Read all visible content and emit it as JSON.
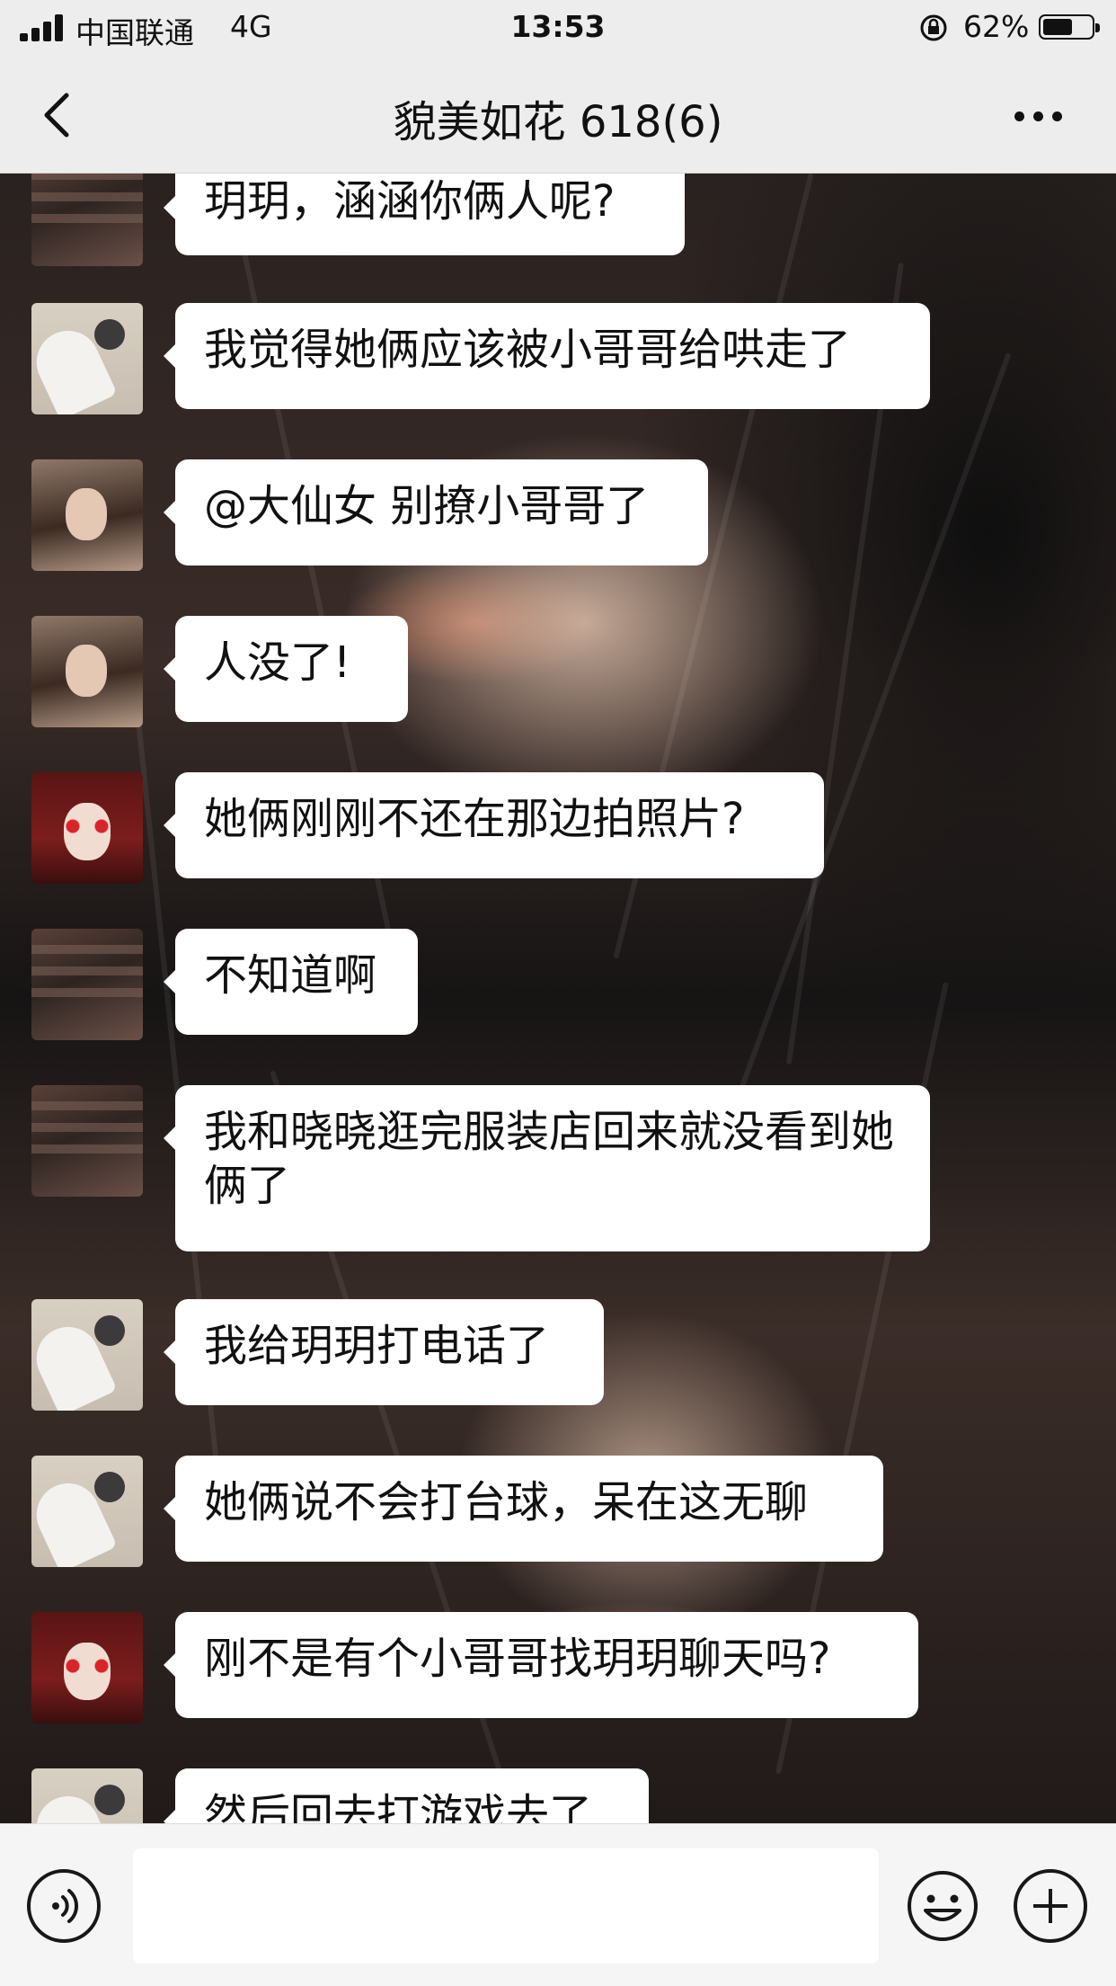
{
  "status_bar": {
    "carrier": "中国联通",
    "network": "4G",
    "time": "13:53",
    "battery_percent": "62%",
    "battery_level": 0.62
  },
  "header": {
    "back_icon": "chevron-left-icon",
    "title": "貌美如花 618(6)",
    "more_icon": "ellipsis-icon"
  },
  "messages": [
    {
      "avatar": "avatar-a",
      "text": "玥玥，涵涵你俩人呢?"
    },
    {
      "avatar": "avatar-b",
      "text": "我觉得她俩应该被小哥哥给哄走了"
    },
    {
      "avatar": "avatar-c",
      "text": "@大仙女 别撩小哥哥了"
    },
    {
      "avatar": "avatar-c",
      "text": "人没了!"
    },
    {
      "avatar": "avatar-d",
      "text": "她俩刚刚不还在那边拍照片?"
    },
    {
      "avatar": "avatar-a",
      "text": "不知道啊"
    },
    {
      "avatar": "avatar-a",
      "text": "我和晓晓逛完服装店回来就没看到她俩了"
    },
    {
      "avatar": "avatar-b",
      "text": "我给玥玥打电话了"
    },
    {
      "avatar": "avatar-b",
      "text": "她俩说不会打台球，呆在这无聊"
    },
    {
      "avatar": "avatar-d",
      "text": "刚不是有个小哥哥找玥玥聊天吗?"
    },
    {
      "avatar": "avatar-b",
      "text": "然后回去打游戏去了"
    }
  ],
  "input_bar": {
    "voice_icon": "voice-icon",
    "input_value": "",
    "emoji_icon": "emoji-icon",
    "plus_icon": "plus-icon"
  }
}
